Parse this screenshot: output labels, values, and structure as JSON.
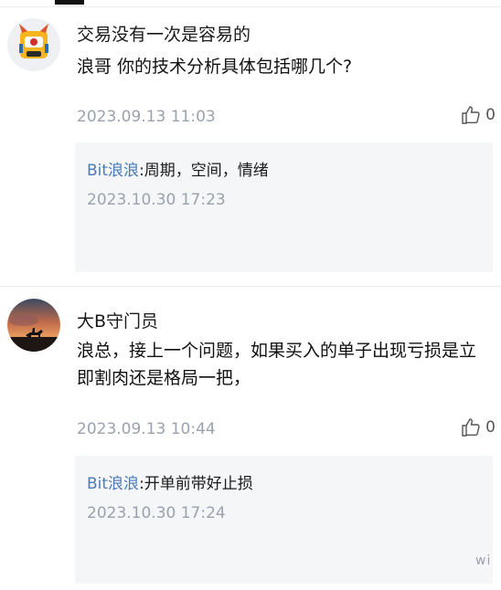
{
  "comments": [
    {
      "username": "交易没有一次是容易的",
      "text": "浪哥 你的技术分析具体包括哪几个?",
      "date": "2023.09.13 11:03",
      "likes": "0",
      "avatar_icon": "yellow-cartoon-avatar-icon",
      "reply": {
        "author": "Bit浪浪",
        "text": ":周期，空间，情绪",
        "date": "2023.10.30 17:23"
      }
    },
    {
      "username": "大B守门员",
      "text": "浪总，接上一个问题，如果买入的单子出现亏损是立即割肉还是格局一把，",
      "date": "2023.09.13 10:44",
      "likes": "0",
      "avatar_icon": "sunset-rider-avatar-icon",
      "reply": {
        "author": "Bit浪浪",
        "text": ":开单前带好止损",
        "date": "2023.10.30 17:24"
      }
    }
  ],
  "watermark": "wi",
  "colors": {
    "reply_author": "#4a7bb7",
    "meta_gray": "#9aa3ad",
    "reply_bg": "#f5f6f8"
  }
}
